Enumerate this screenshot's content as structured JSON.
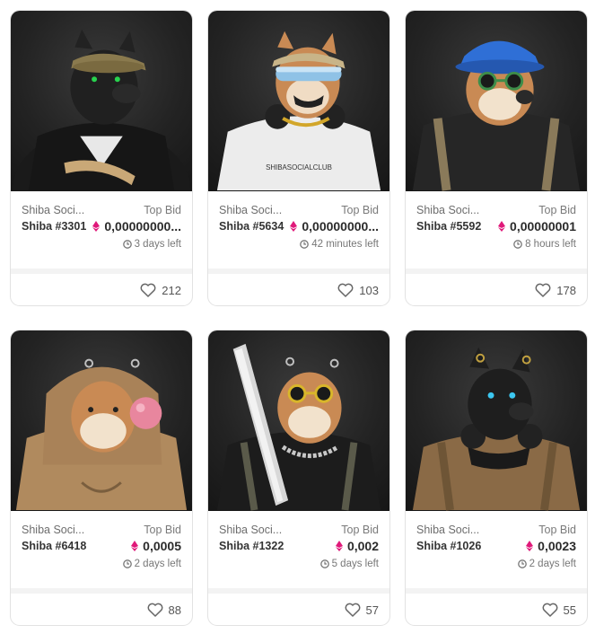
{
  "cards": [
    {
      "collection": "Shiba Soci...",
      "top_bid_label": "Top Bid",
      "token": "Shiba #3301",
      "price": "0,00000000...",
      "time_left": "3 days left",
      "likes": "212",
      "icon": "eth-icon",
      "accent": "#1fb24a"
    },
    {
      "collection": "Shiba Soci...",
      "top_bid_label": "Top Bid",
      "token": "Shiba #5634",
      "price": "0,00000000...",
      "time_left": "42 minutes left",
      "likes": "103",
      "icon": "eth-icon",
      "accent": "#a8d6ff"
    },
    {
      "collection": "Shiba Soci...",
      "top_bid_label": "Top Bid",
      "token": "Shiba #5592",
      "price": "0,00000001",
      "time_left": "8 hours left",
      "likes": "178",
      "icon": "eth-icon",
      "accent": "#2f6fd6"
    },
    {
      "collection": "Shiba Soci...",
      "top_bid_label": "Top Bid",
      "token": "Shiba #6418",
      "price": "0,0005",
      "time_left": "2 days left",
      "likes": "88",
      "icon": "eth-icon",
      "accent": "#e8869e"
    },
    {
      "collection": "Shiba Soci...",
      "top_bid_label": "Top Bid",
      "token": "Shiba #1322",
      "price": "0,002",
      "time_left": "5 days left",
      "likes": "57",
      "icon": "eth-icon",
      "accent": "#d9b62a"
    },
    {
      "collection": "Shiba Soci...",
      "top_bid_label": "Top Bid",
      "token": "Shiba #1026",
      "price": "0,0023",
      "time_left": "2 days left",
      "likes": "55",
      "icon": "eth-icon",
      "accent": "#3cc7f0"
    }
  ],
  "colors": {
    "eth": "#e0197a",
    "border": "#e2e2e2",
    "image_bg": "#232323"
  },
  "icons": [
    "eth-icon",
    "clock-icon",
    "heart-icon"
  ]
}
